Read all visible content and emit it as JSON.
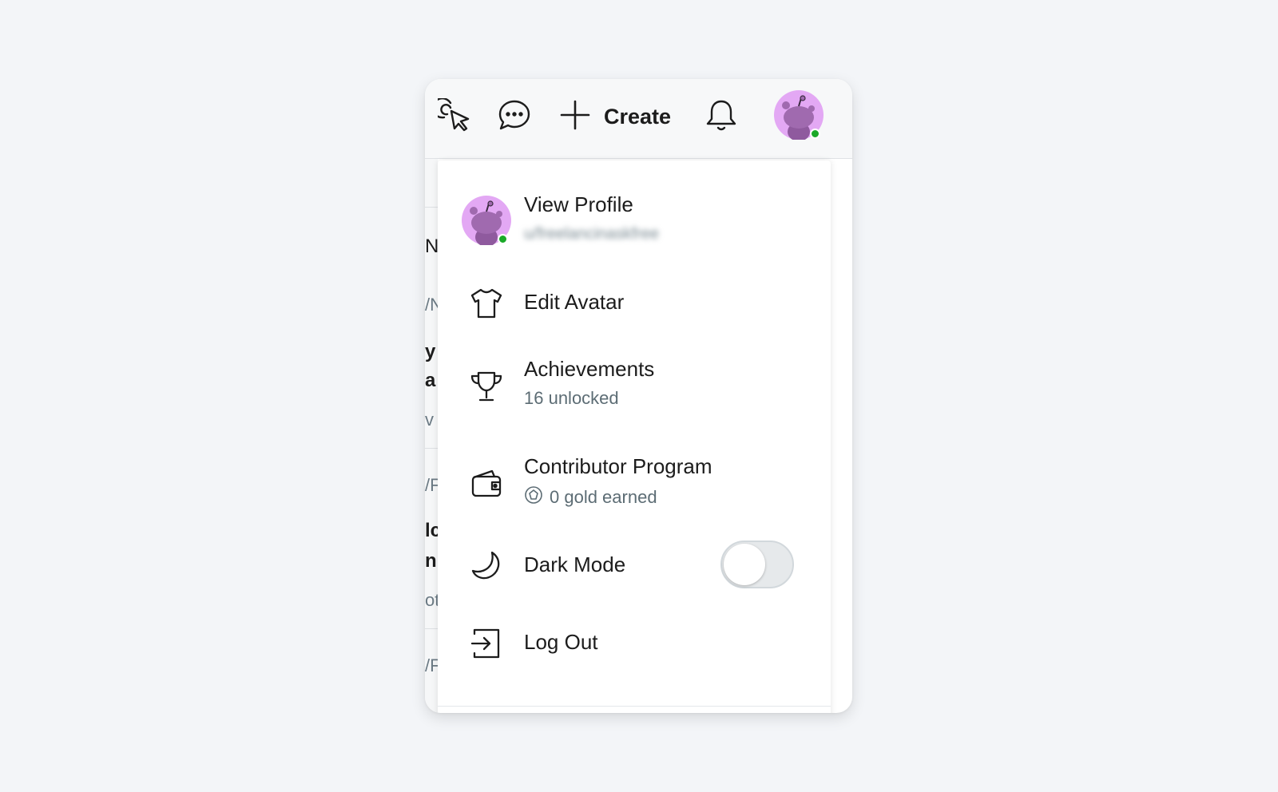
{
  "header": {
    "create_label": "Create"
  },
  "menu": {
    "view_profile": {
      "label": "View Profile",
      "username": "u/freelancinaskfree"
    },
    "edit_avatar": {
      "label": "Edit Avatar"
    },
    "achievements": {
      "label": "Achievements",
      "sub": "16 unlocked"
    },
    "contributor": {
      "label": "Contributor Program",
      "sub": "0 gold earned"
    },
    "dark_mode": {
      "label": "Dark Mode",
      "enabled": false
    },
    "log_out": {
      "label": "Log Out"
    }
  },
  "background_fragments": [
    "N",
    "/N",
    "y",
    "a",
    "v",
    "/F",
    "lc",
    "n",
    "ot",
    "/F"
  ],
  "icons": {
    "popular": "cursor-click-icon",
    "chat": "chat-icon",
    "create": "plus-icon",
    "notifications": "bell-icon",
    "avatar": "avatar-icon",
    "edit_avatar": "shirt-icon",
    "achievements": "trophy-icon",
    "contributor": "wallet-icon",
    "gold": "gold-badge-icon",
    "dark_mode": "moon-icon",
    "log_out": "log-out-icon"
  },
  "colors": {
    "avatar_bg": "#e3a8f4",
    "online": "#1aa928",
    "secondary_text": "#5c6c74"
  }
}
